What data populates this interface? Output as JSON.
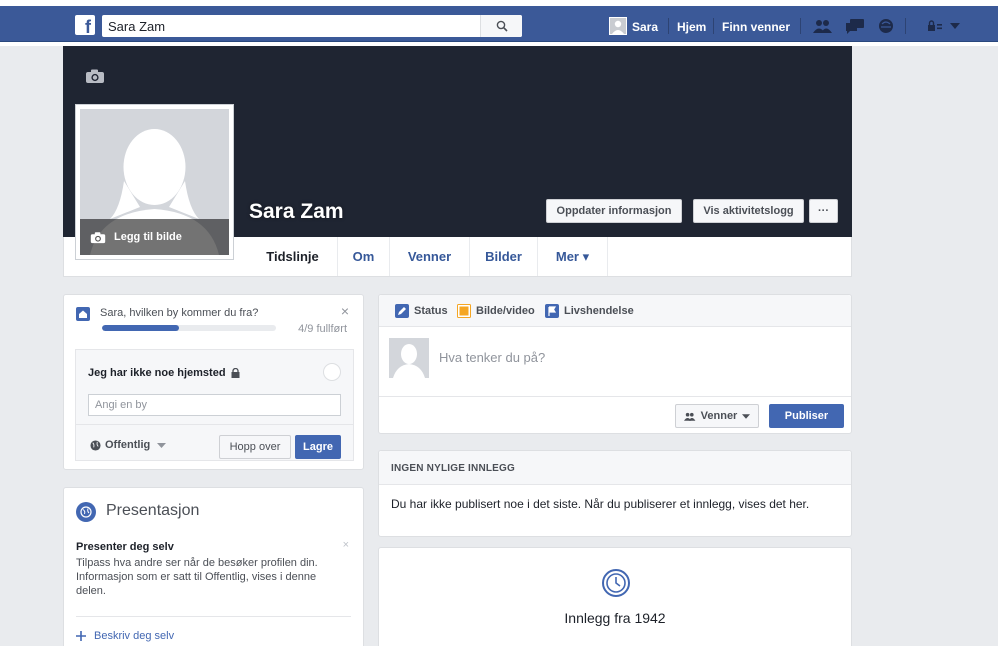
{
  "topbar": {
    "logo": "f",
    "search": {
      "value": "Sara Zam",
      "placeholder": ""
    },
    "user_name": "Sara",
    "home": "Hjem",
    "find_friends": "Finn venner",
    "icons": [
      "friends-icon",
      "messages-icon",
      "notifications-icon",
      "privacy-icon",
      "dropdown-arrow-icon"
    ]
  },
  "profile": {
    "name": "Sara Zam",
    "add_photo": "Legg til bilde",
    "buttons": {
      "update_info": "Oppdater informasjon",
      "activity_log": "Vis aktivitetslogg",
      "more": "···"
    },
    "tabs": [
      {
        "label": "Tidslinje",
        "active": true
      },
      {
        "label": "Om",
        "active": false
      },
      {
        "label": "Venner",
        "active": false
      },
      {
        "label": "Bilder",
        "active": false
      },
      {
        "label": "Mer ▾",
        "active": false
      }
    ]
  },
  "hometown_card": {
    "question": "Sara, hvilken by kommer du fra?",
    "close": "×",
    "progress_fraction": 0.444,
    "progress_label": "4/9 fullført",
    "no_hometown": "Jeg har ikke noe hjemsted",
    "city_placeholder": "Angi en by",
    "privacy": "Offentlig",
    "skip": "Hopp over",
    "save": "Lagre"
  },
  "intro_card": {
    "title": "Presentasjon",
    "present_title": "Presenter deg selv",
    "close": "×",
    "present_desc": "Tilpass hva andre ser når de besøker profilen din. Informasjon som er satt til Offentlig, vises i denne delen.",
    "describe_link": "Beskriv deg selv"
  },
  "composer": {
    "tabs": [
      "Status",
      "Bilde/video",
      "Livshendelse"
    ],
    "placeholder": "Hva tenker du på?",
    "audience": "Venner",
    "publish": "Publiser"
  },
  "no_posts": {
    "header": "INGEN NYLIGE INNLEGG",
    "body": "Du har ikke publisert noe i det siste. Når du publiserer et innlegg, vises det her."
  },
  "posts_from": {
    "label": "Innlegg fra 1942"
  },
  "colors": {
    "brand": "#3b5998",
    "accent": "#4267b2",
    "cover": "#1f2532",
    "background": "#e9ebee"
  }
}
